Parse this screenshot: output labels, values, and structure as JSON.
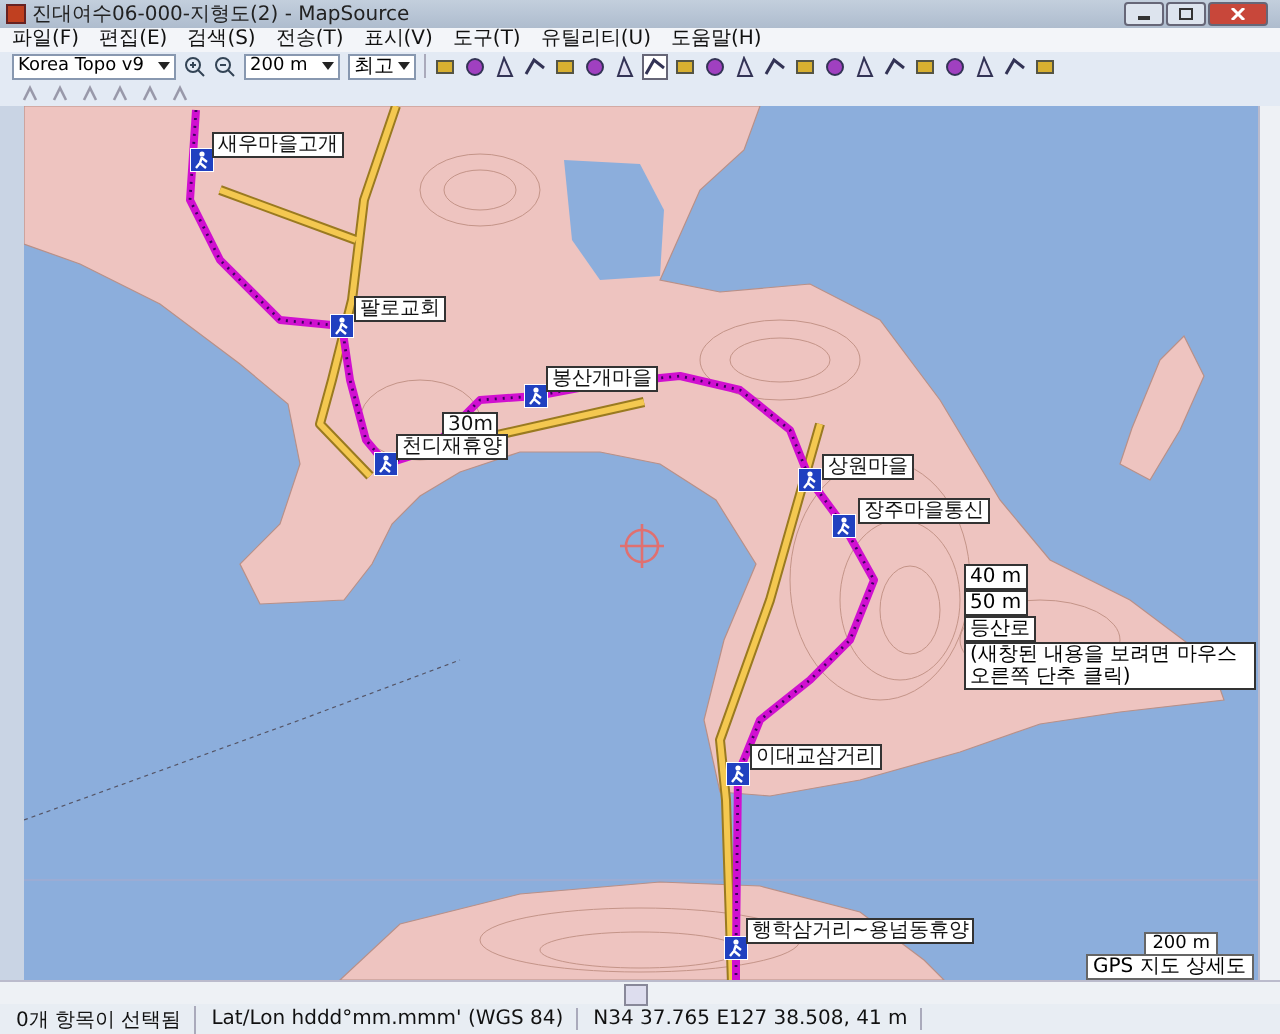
{
  "window": {
    "title": "진대여수06-000-지형도(2) - MapSource"
  },
  "menu": [
    "파일(F)",
    "편집(E)",
    "검색(S)",
    "전송(T)",
    "표시(V)",
    "도구(T)",
    "유틸리티(U)",
    "도움말(H)"
  ],
  "toolbar": {
    "map_product": "Korea Topo v9",
    "zoom_level": "200 m",
    "detail": "최고"
  },
  "map": {
    "waypoints": [
      {
        "label": "새우마을고개",
        "kind": "hiker"
      },
      {
        "label": "팔로교회",
        "kind": "hiker"
      },
      {
        "label": "봉산개마을",
        "kind": "hiker"
      },
      {
        "label": "30m",
        "kind": "note"
      },
      {
        "label": "천디재휴양",
        "kind": "hiker"
      },
      {
        "label": "상원마을",
        "kind": "hiker"
      },
      {
        "label": "장주마을통신",
        "kind": "hiker"
      },
      {
        "label": "이대교삼거리",
        "kind": "hiker"
      },
      {
        "label": "행학삼거리~용넘동휴양",
        "kind": "hiker"
      }
    ],
    "tooltip": [
      "40 m",
      "50 m",
      "등산로",
      "(새창된 내용을 보려면 마우스 오른쪽 단추 클릭)"
    ],
    "scale": "200 m",
    "map_detail": "GPS 지도 상세도"
  },
  "status_bar": [
    "0개 항목이 선택됨",
    "Lat/Lon hddd°mm.mmm' (WGS 84)",
    "N34 37.765 E127 38.508, 41 m"
  ]
}
